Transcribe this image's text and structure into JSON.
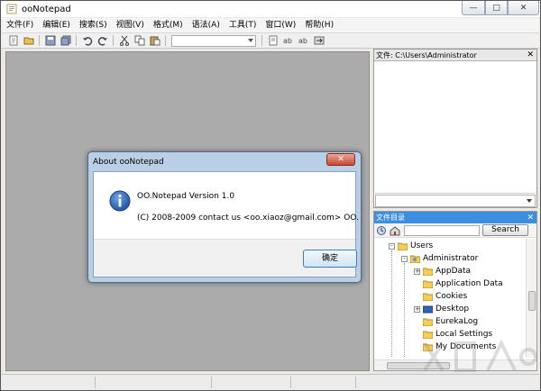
{
  "window": {
    "title": "ooNotepad",
    "controls": {
      "minimize": "—",
      "maximize": "□",
      "close": "✕"
    }
  },
  "menu": {
    "items": [
      {
        "label": "文件(F)"
      },
      {
        "label": "编辑(E)"
      },
      {
        "label": "搜索(S)"
      },
      {
        "label": "视图(V)"
      },
      {
        "label": "格式(M)"
      },
      {
        "label": "语法(A)"
      },
      {
        "label": "工具(T)"
      },
      {
        "label": "窗口(W)"
      },
      {
        "label": "帮助(H)"
      }
    ]
  },
  "toolbar": {
    "icons": [
      "new-file-icon",
      "open-file-icon",
      "save-icon",
      "save-all-icon",
      "undo-icon",
      "redo-icon",
      "cut-icon",
      "copy-icon",
      "paste-icon",
      "find-icon",
      "replace-icon",
      "find-next-icon",
      "goto-icon"
    ]
  },
  "file_panel": {
    "header": "文件: C:\\Users\\Administrator",
    "close": "✕"
  },
  "dir_panel": {
    "header": "文件目录",
    "close": "✕",
    "search_button": "Search",
    "tree": [
      {
        "label": "Users",
        "level": 0,
        "expander": "-"
      },
      {
        "label": "Administrator",
        "level": 1,
        "expander": "-"
      },
      {
        "label": "AppData",
        "level": 2,
        "expander": "+"
      },
      {
        "label": "Application Data",
        "level": 2,
        "expander": ""
      },
      {
        "label": "Cookies",
        "level": 2,
        "expander": ""
      },
      {
        "label": "Desktop",
        "level": 2,
        "expander": "+"
      },
      {
        "label": "EurekaLog",
        "level": 2,
        "expander": ""
      },
      {
        "label": "Local Settings",
        "level": 2,
        "expander": ""
      },
      {
        "label": "My Documents",
        "level": 2,
        "expander": ""
      }
    ]
  },
  "about_dialog": {
    "title": "About ooNotepad",
    "close": "✕",
    "version_text": "OO.Notepad Version 1.0",
    "copyright_text": "(C) 2008-2009 contact us <oo.xiaoz@gmail.com> OO.",
    "ok_label": "确定"
  },
  "colors": {
    "dir_header": "#3c8fe0",
    "editor_bg": "#ababab",
    "dialog_frame": "#b9cfe6",
    "close_button": "#c74a34"
  }
}
